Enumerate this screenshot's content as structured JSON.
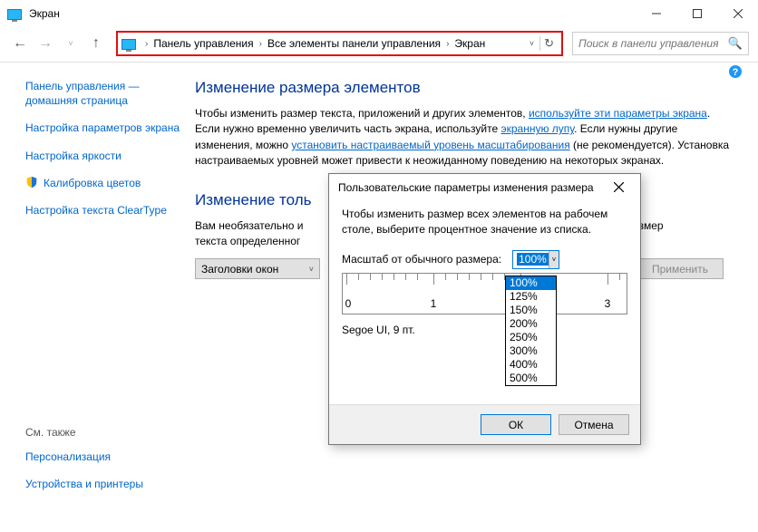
{
  "window": {
    "title": "Экран"
  },
  "breadcrumb": {
    "c1": "Панель управления",
    "c2": "Все элементы панели управления",
    "c3": "Экран"
  },
  "search": {
    "placeholder": "Поиск в панели управления"
  },
  "sidebar": {
    "home": "Панель управления — домашняя страница",
    "item1": "Настройка параметров экрана",
    "item2": "Настройка яркости",
    "item3": "Калибровка цветов",
    "item4": "Настройка текста ClearType",
    "see_also": "См. также",
    "see1": "Персонализация",
    "see2": "Устройства и принтеры"
  },
  "main": {
    "h1": "Изменение размера элементов",
    "p1a": "Чтобы изменить размер текста, приложений и других элементов, ",
    "p1link1": "используйте эти параметры экрана",
    "p1b": ". Если нужно временно увеличить часть экрана, используйте ",
    "p1link2": "экранную лупу",
    "p1c": ". Если нужны другие изменения, можно ",
    "p1link3": "установить настраиваемый уровень масштабирования",
    "p1d": " (не рекомендуется). Установка настраиваемых уровней может привести к неожиданному поведению на некоторых экранах.",
    "h2": "Изменение толь",
    "p2a": "Вам необязательно и",
    "p2b": "только размер",
    "p2c": "текста определенног",
    "combo_label": "Заголовки окон",
    "apply": "Применить"
  },
  "dialog": {
    "title": "Пользовательские параметры изменения размера",
    "desc": "Чтобы изменить размер всех элементов на рабочем столе, выберите процентное значение из списка.",
    "scale_label": "Масштаб от обычного размера:",
    "scale_value": "100%",
    "ruler": {
      "n0": "0",
      "n1": "1",
      "n3": "3"
    },
    "font_sample": "Segoe UI, 9 пт.",
    "ok": "ОК",
    "cancel": "Отмена"
  },
  "dropdown": {
    "o1": "100%",
    "o2": "125%",
    "o3": "150%",
    "o4": "200%",
    "o5": "250%",
    "o6": "300%",
    "o7": "400%",
    "o8": "500%"
  }
}
